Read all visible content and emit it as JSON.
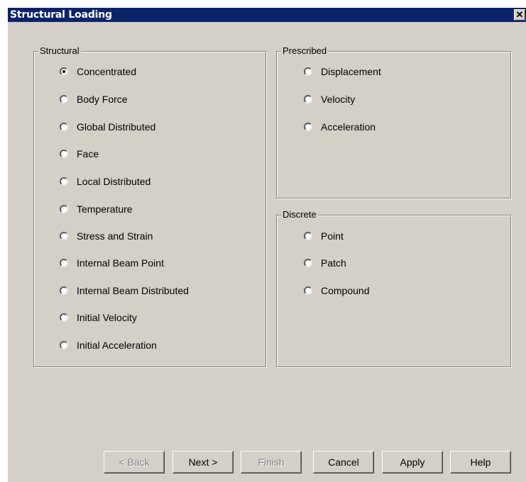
{
  "window": {
    "title": "Structural Loading",
    "close_label": "✕"
  },
  "structural": {
    "label": "Structural",
    "options": [
      {
        "label": "Concentrated",
        "checked": true
      },
      {
        "label": "Body Force",
        "checked": false
      },
      {
        "label": "Global Distributed",
        "checked": false
      },
      {
        "label": "Face",
        "checked": false
      },
      {
        "label": "Local Distributed",
        "checked": false
      },
      {
        "label": "Temperature",
        "checked": false
      },
      {
        "label": "Stress and Strain",
        "checked": false
      },
      {
        "label": "Internal Beam Point",
        "checked": false
      },
      {
        "label": "Internal Beam Distributed",
        "checked": false
      },
      {
        "label": "Initial Velocity",
        "checked": false
      },
      {
        "label": "Initial Acceleration",
        "checked": false
      }
    ]
  },
  "prescribed": {
    "label": "Prescribed",
    "options": [
      {
        "label": "Displacement",
        "checked": false
      },
      {
        "label": "Velocity",
        "checked": false
      },
      {
        "label": "Acceleration",
        "checked": false
      }
    ]
  },
  "discrete": {
    "label": "Discrete",
    "options": [
      {
        "label": "Point",
        "checked": false
      },
      {
        "label": "Patch",
        "checked": false
      },
      {
        "label": "Compound",
        "checked": false
      }
    ]
  },
  "buttons": {
    "back": {
      "label": "< Back",
      "enabled": false
    },
    "next": {
      "label": "Next >",
      "enabled": true
    },
    "finish": {
      "label": "Finish",
      "enabled": false
    },
    "cancel": {
      "label": "Cancel",
      "enabled": true
    },
    "apply": {
      "label": "Apply",
      "enabled": true
    },
    "help": {
      "label": "Help",
      "enabled": true
    }
  }
}
